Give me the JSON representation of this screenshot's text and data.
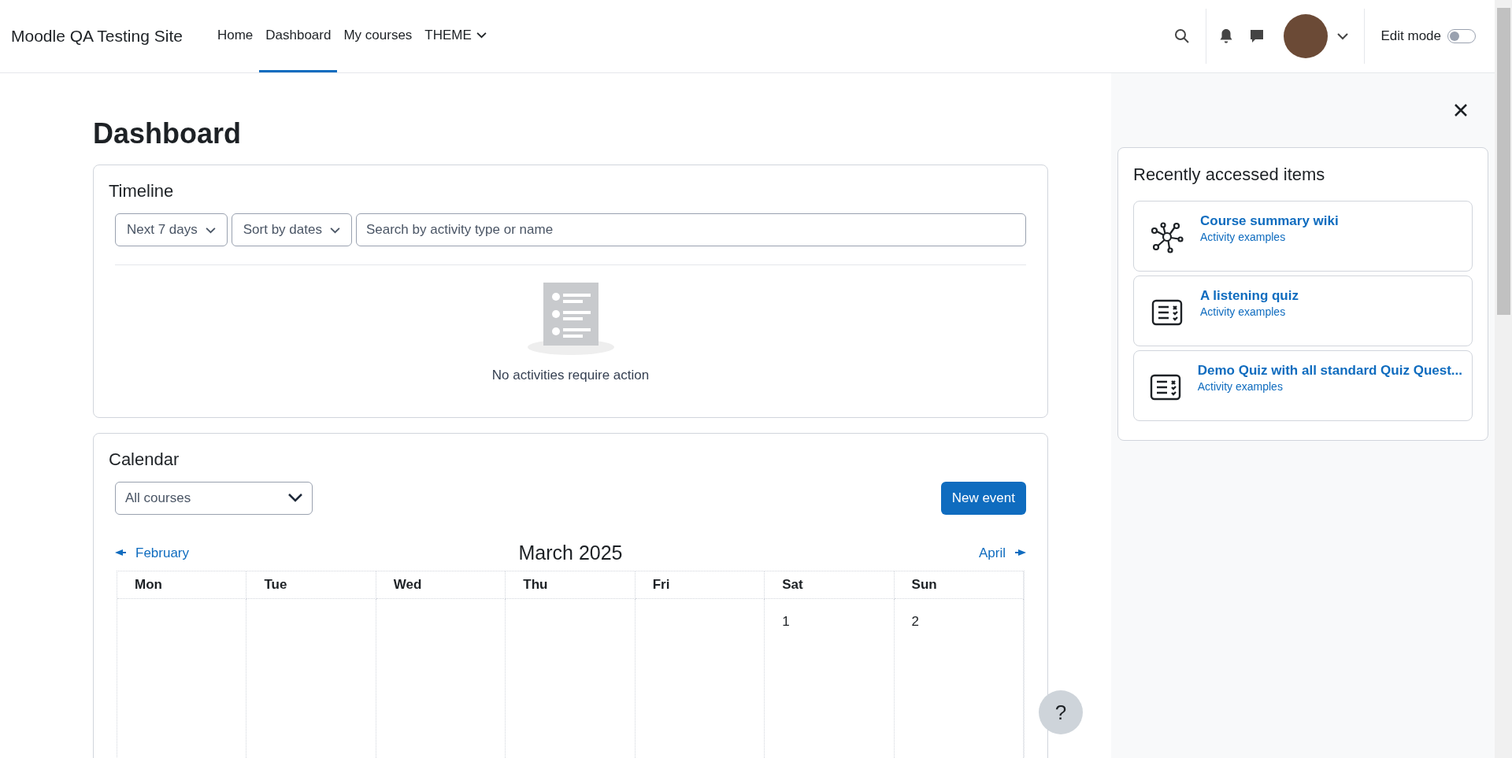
{
  "header": {
    "brand": "Moodle QA Testing Site",
    "nav": [
      {
        "label": "Home",
        "selected": false,
        "kind": "link"
      },
      {
        "label": "Dashboard",
        "selected": true,
        "kind": "link"
      },
      {
        "label": "My courses",
        "selected": false,
        "kind": "link"
      },
      {
        "label": "THEME",
        "selected": false,
        "kind": "menu"
      }
    ],
    "edit_mode": {
      "label": "Edit mode",
      "on": false
    }
  },
  "page_title": "Dashboard",
  "timeline": {
    "title": "Timeline",
    "filters": [
      "Next 7 days",
      "Sort by dates"
    ],
    "search": {
      "placeholder": "Search by activity type or name"
    },
    "empty_text": "No activities require action"
  },
  "calendar": {
    "title": "Calendar",
    "course_select": "All courses",
    "new_event": "New event",
    "prev": "February",
    "month": "March 2025",
    "next": "April",
    "weekdays": [
      "Mon",
      "Tue",
      "Wed",
      "Thu",
      "Fri",
      "Sat",
      "Sun"
    ],
    "weeks": [
      [
        {
          "kind": "blank"
        },
        {
          "kind": "blank"
        },
        {
          "kind": "blank"
        },
        {
          "kind": "blank"
        },
        {
          "kind": "blank"
        },
        {
          "kind": "day",
          "label": "1"
        },
        {
          "kind": "day",
          "label": "2"
        }
      ]
    ]
  },
  "drawer": {
    "title": "Recently accessed items",
    "items": [
      {
        "title": "Course summary wiki",
        "subtitle": "Activity examples",
        "kind": "wiki"
      },
      {
        "title": "A listening quiz",
        "subtitle": "Activity examples",
        "kind": "quiz"
      },
      {
        "title": "Demo Quiz with all standard Quiz Quest...",
        "subtitle": "Activity examples",
        "kind": "quiz"
      }
    ]
  },
  "help": "?"
}
